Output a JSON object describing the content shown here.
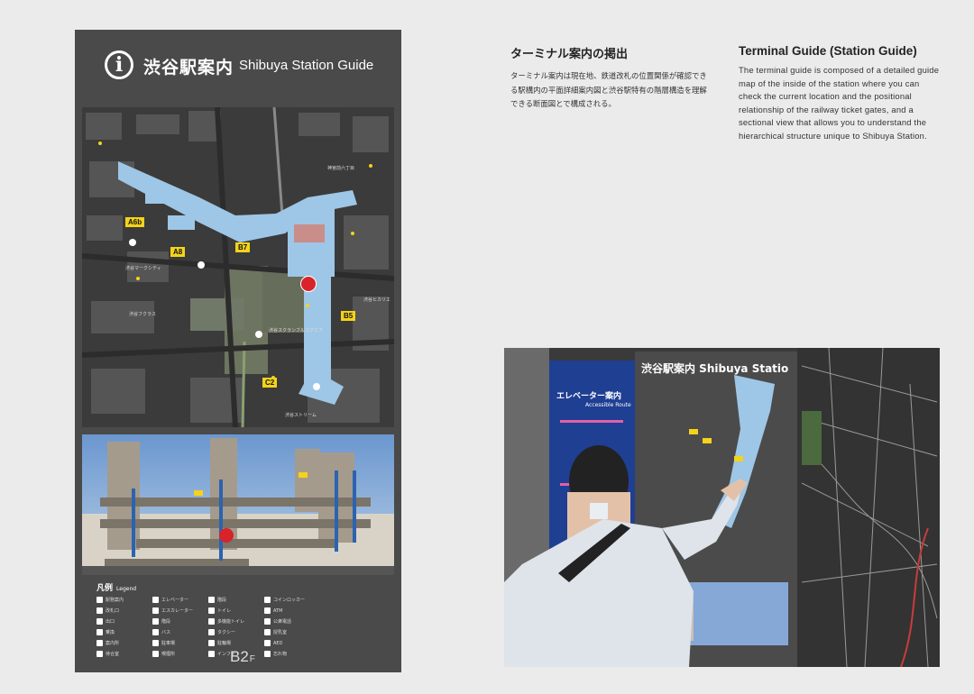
{
  "sign": {
    "title_ja": "渋谷駅案内",
    "title_en": "Shibuya Station Guide",
    "info_glyph": "i",
    "floor": "B2",
    "floor_suffix": "F",
    "legend_title": "凡例",
    "legend_sub": "Legend",
    "legend_items": [
      "駅務案内",
      "エレベーター",
      "階段",
      "コインロッカー",
      "改札口",
      "エスカレーター",
      "トイレ",
      "ATM",
      "出口",
      "階段",
      "多機能トイレ",
      "公衆電話",
      "乗換",
      "バス",
      "タクシー",
      "授乳室",
      "案内所",
      "駐車場",
      "駐輪場",
      "AED",
      "待合室",
      "喫煙所",
      "インフォ",
      "忘れ物"
    ],
    "map_tags": [
      "A6b",
      "A8",
      "B7",
      "B5",
      "C2"
    ],
    "map_labels": [
      "渋谷マークシティ",
      "渋谷フクラス",
      "渋谷スクランブルスクエア",
      "渋谷ヒカリエ",
      "神宮前六丁目",
      "渋谷ストリーム"
    ]
  },
  "ja": {
    "heading": "ターミナル案内の掲出",
    "body": "ターミナル案内は現在地、鉄道改札の位置関係が確認できる駅構内の平面詳細案内図と渋谷駅特有の階層構造を理解できる断面図とで構成される。"
  },
  "en": {
    "heading": "Terminal Guide (Station Guide)",
    "body": "The terminal guide is composed of a detailed guide map of the inside of the station where you can check the current location and the positional relationship of the railway ticket gates, and a sectional view that allows you to understand the hierarchical structure unique to Shibuya Station."
  },
  "photo": {
    "sign_title": "渋谷駅案内 Shibuya Statio",
    "elevator_ja": "エレベーター案内",
    "elevator_en": "Accessible Route"
  },
  "colors": {
    "sign_bg": "#4a4a4a",
    "map_bg": "#3c3c3c",
    "accent_yellow": "#f4d31a",
    "station_blue": "#9ec6e6",
    "pin_red": "#d8232a"
  }
}
